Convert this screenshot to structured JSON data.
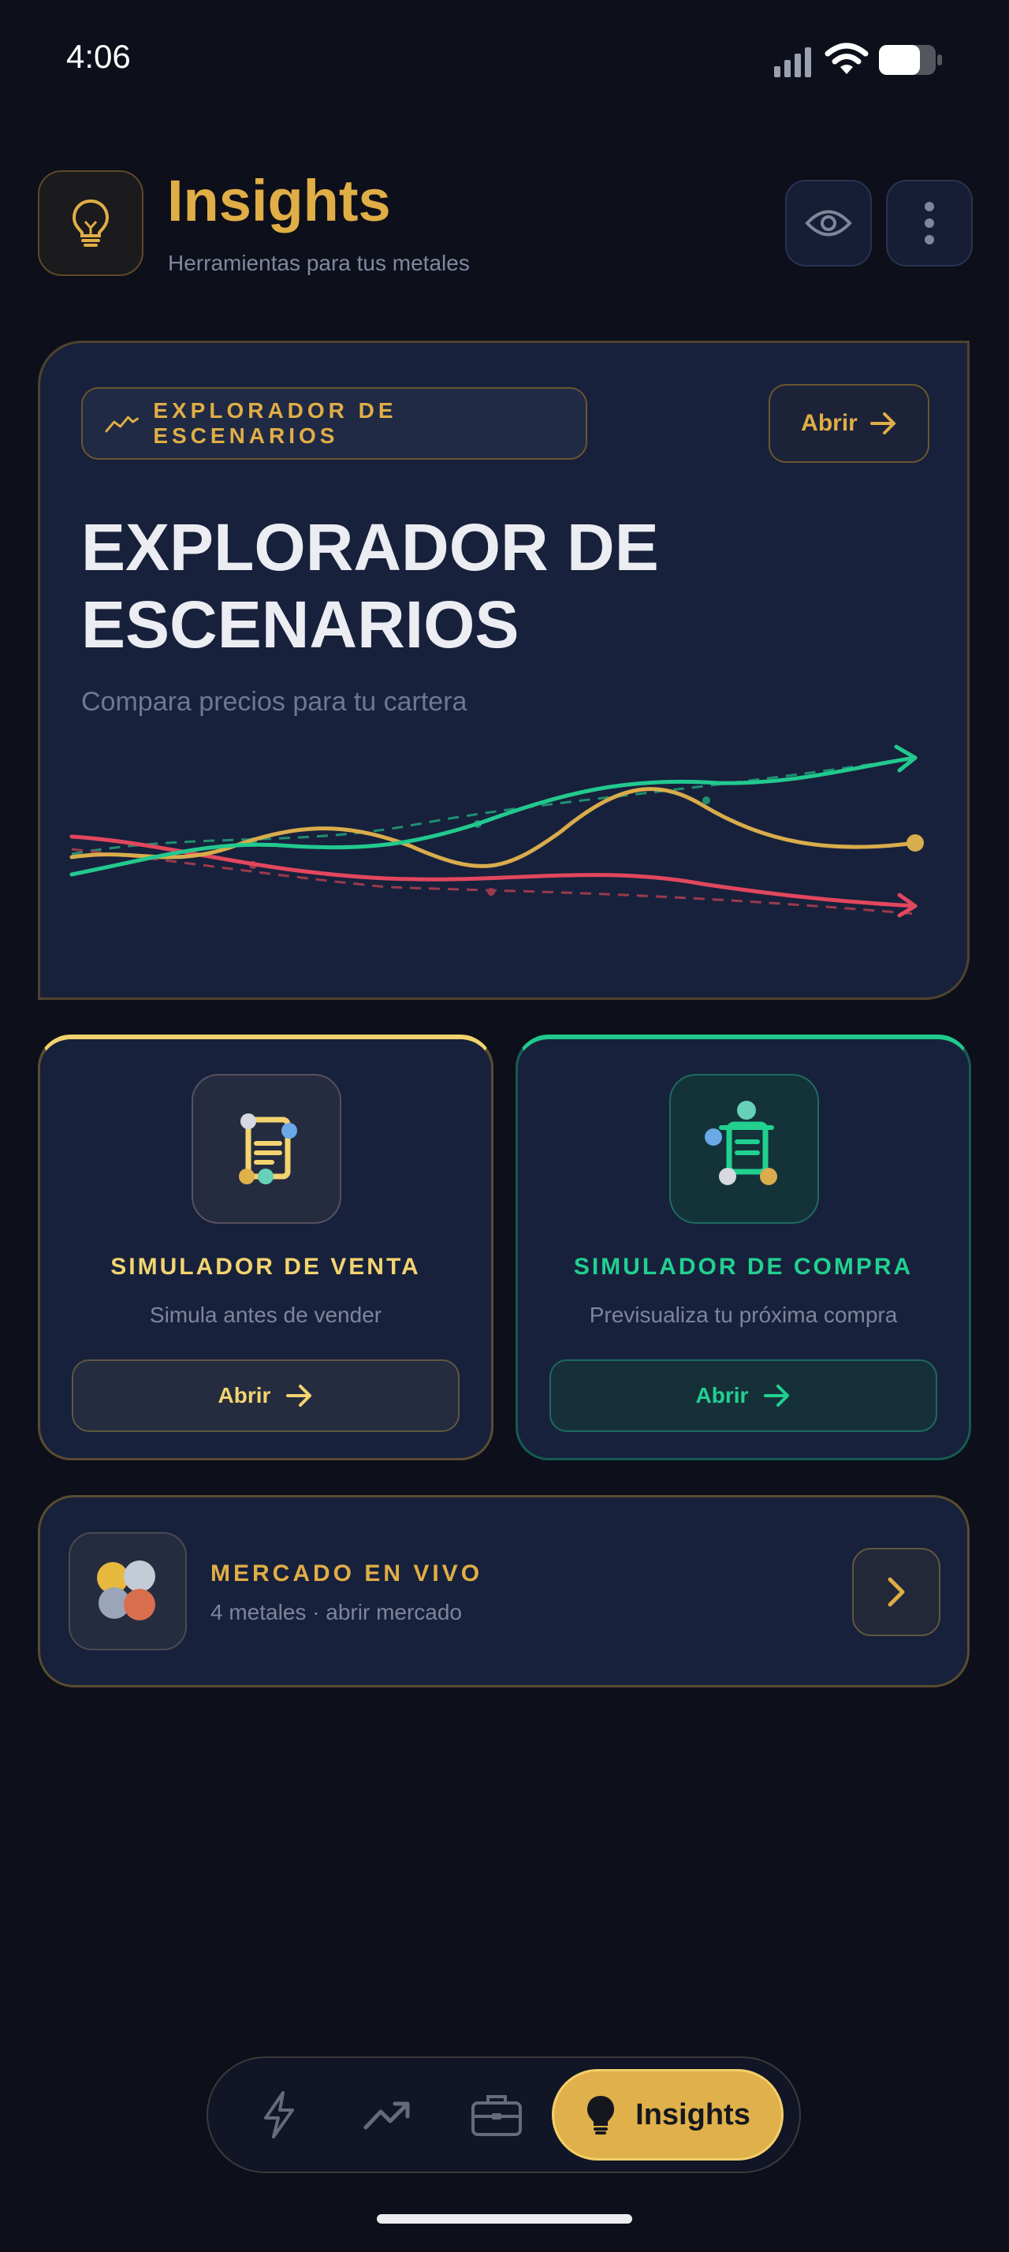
{
  "status_bar": {
    "time": "4:06"
  },
  "header": {
    "title": "Insights",
    "subtitle": "Herramientas para tus metales",
    "logo_icon": "lightbulb-icon",
    "actions": [
      "eye-icon",
      "more-vertical-icon"
    ]
  },
  "hero": {
    "pill_label": "EXPLORADOR DE ESCENARIOS",
    "open_label": "Abrir",
    "title": "EXPLORADOR DE ESCENARIOS",
    "subtitle": "Compara precios para tu cartera",
    "line_colors": [
      "#22c98e",
      "#d9ac4c",
      "#e2475e"
    ]
  },
  "simulators": [
    {
      "title": "SIMULADOR DE VENTA",
      "subtitle": "Simula antes de vender",
      "button": "Abrir",
      "accent": "#f3d470"
    },
    {
      "title": "SIMULADOR DE COMPRA",
      "subtitle": "Previsualiza tu próxima compra",
      "button": "Abrir",
      "accent": "#22d090"
    }
  ],
  "market": {
    "title": "MERCADO EN VIVO",
    "subtitle": "4 metales · abrir mercado"
  },
  "nav": {
    "items": [
      "bolt-icon",
      "trending-up-icon",
      "briefcase-icon"
    ],
    "active_label": "Insights",
    "active_icon": "lightbulb-icon"
  },
  "colors": {
    "accent": "#e0ae46",
    "background": "#0d0f1a",
    "card": "#18213b"
  }
}
